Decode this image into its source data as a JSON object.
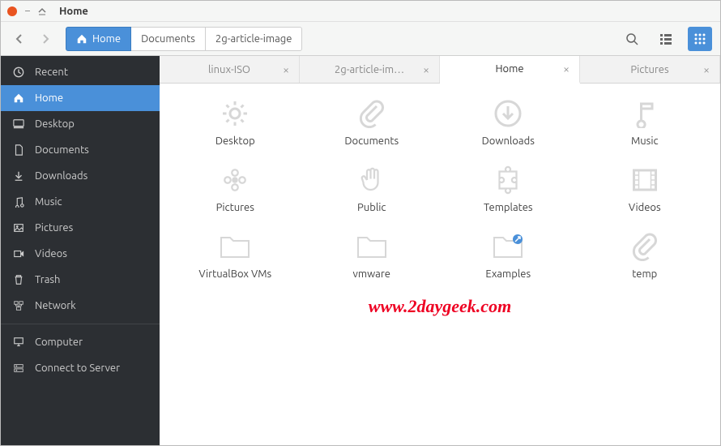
{
  "titlebar": {
    "title": "Home"
  },
  "toolbar": {
    "path": [
      {
        "label": "Home",
        "active": true,
        "icon": "home"
      },
      {
        "label": "Documents",
        "active": false
      },
      {
        "label": "2g-article-image",
        "active": false
      }
    ]
  },
  "sidebar": {
    "items": [
      {
        "label": "Recent",
        "icon": "clock"
      },
      {
        "label": "Home",
        "icon": "home",
        "active": true
      },
      {
        "label": "Desktop",
        "icon": "desktop"
      },
      {
        "label": "Documents",
        "icon": "documents"
      },
      {
        "label": "Downloads",
        "icon": "downloads"
      },
      {
        "label": "Music",
        "icon": "music"
      },
      {
        "label": "Pictures",
        "icon": "pictures"
      },
      {
        "label": "Videos",
        "icon": "videos"
      },
      {
        "label": "Trash",
        "icon": "trash"
      },
      {
        "label": "Network",
        "icon": "network"
      },
      {
        "sep": true
      },
      {
        "label": "Computer",
        "icon": "computer"
      },
      {
        "label": "Connect to Server",
        "icon": "server"
      }
    ]
  },
  "tabs": [
    {
      "label": "linux-ISO",
      "active": false
    },
    {
      "label": "2g-article-im…",
      "active": false
    },
    {
      "label": "Home",
      "active": true
    },
    {
      "label": "Pictures",
      "active": false
    }
  ],
  "grid": [
    {
      "label": "Desktop",
      "icon": "gear"
    },
    {
      "label": "Documents",
      "icon": "clip"
    },
    {
      "label": "Downloads",
      "icon": "down"
    },
    {
      "label": "Music",
      "icon": "note"
    },
    {
      "label": "Pictures",
      "icon": "flower"
    },
    {
      "label": "Public",
      "icon": "hand"
    },
    {
      "label": "Templates",
      "icon": "puzzle"
    },
    {
      "label": "Videos",
      "icon": "film"
    },
    {
      "label": "VirtualBox VMs",
      "icon": "folder"
    },
    {
      "label": "vmware",
      "icon": "folder"
    },
    {
      "label": "Examples",
      "icon": "link"
    },
    {
      "label": "temp",
      "icon": "clip"
    }
  ],
  "watermark": "www.2daygeek.com"
}
